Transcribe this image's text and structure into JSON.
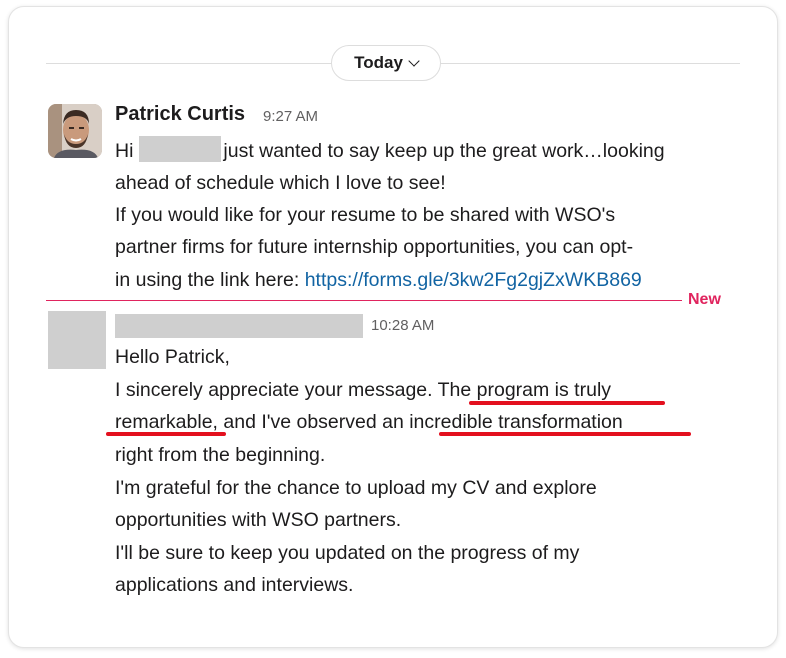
{
  "date_divider": {
    "label": "Today"
  },
  "message1": {
    "sender": "Patrick Curtis",
    "time": "9:27 AM",
    "line1_prefix": "Hi",
    "line1_suffix": "just wanted to say keep up the great work…looking",
    "line2": "ahead of schedule which I love to see!",
    "line3": "If you would like for your resume to be shared with WSO's",
    "line4": "partner firms for future internship opportunities, you can opt-",
    "line5_prefix": "in using the link here: ",
    "link": "https://forms.gle/3kw2Fg2gjZxWKB869"
  },
  "new_divider": {
    "label": "New"
  },
  "message2": {
    "time": "10:28 AM",
    "line1": "Hello Patrick,",
    "line2": "I sincerely appreciate your message. The program is truly",
    "line3": "remarkable, and I've observed an incredible transformation",
    "line4": "right from the beginning.",
    "line5": "I'm grateful for the chance to upload my CV and explore",
    "line6": "opportunities with WSO partners.",
    "line7": "I'll be sure to keep you updated on the progress of my",
    "line8": "applications and interviews."
  },
  "colors": {
    "link": "#1264a3",
    "new_divider": "#e0245e",
    "underline": "#e3101e"
  }
}
